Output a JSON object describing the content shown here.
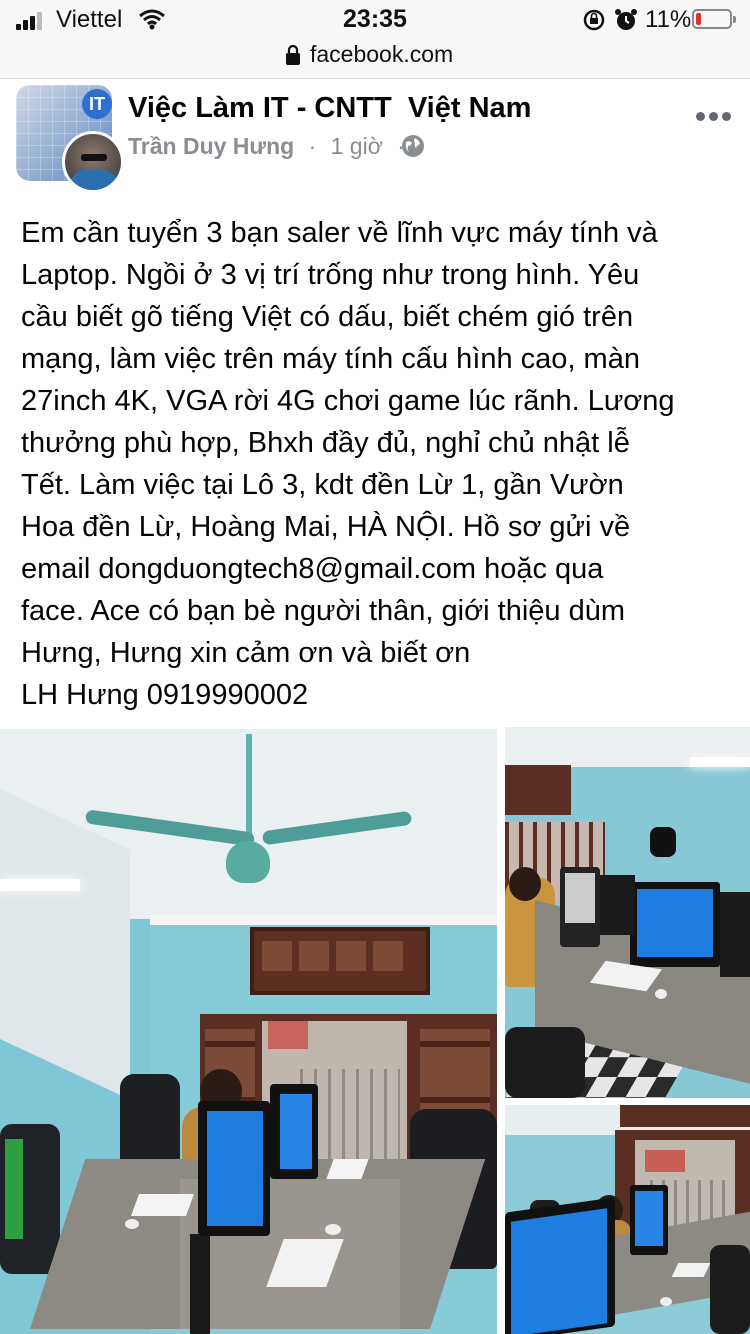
{
  "status_bar": {
    "carrier": "Viettel",
    "time": "23:35",
    "battery_percent": "11%",
    "battery_level": 0.11,
    "icons": [
      "signal-icon",
      "wifi-icon",
      "rotation-lock-icon",
      "alarm-icon",
      "battery-icon"
    ]
  },
  "browser": {
    "url": "facebook.com",
    "icons": [
      "lock-icon"
    ]
  },
  "post": {
    "group_name": "Việc Làm IT - CNTT  Việt Nam",
    "group_badge": "IT",
    "author": "Trần Duy Hưng",
    "time_ago": "1 giờ",
    "separator": "·",
    "icons": [
      "globe-icon",
      "more-options-icon"
    ],
    "body_lines": [
      "Em cần tuyển 3 bạn saler về lĩnh vực máy tính và",
      "Laptop. Ngồi ở 3 vị trí trống như trong hình. Yêu",
      "cầu biết gõ tiếng Việt có dấu, biết chém gió trên",
      "mạng, làm việc trên máy tính cấu hình cao, màn",
      "27inch 4K, VGA rời 4G chơi game lúc rãnh. Lương",
      "thưởng phù hợp, Bhxh đầy đủ, nghỉ chủ nhật lễ",
      "Tết. Làm việc tại Lô 3, kdt đền Lừ 1, gần Vườn",
      "Hoa đền Lừ, Hoàng Mai, HÀ NỘI. Hồ sơ gửi về",
      "email dongduongtech8@gmail.com hoặc qua",
      "face. Ace có bạn bè người thân, giới thiệu dùm",
      "Hưng, Hưng xin cảm ơn và biết ơn",
      "LH Hưng 0919990002"
    ]
  },
  "colors": {
    "wall": "#7fc7d7",
    "ceiling": "#e8eef0",
    "desk": "#8a8680",
    "monitor_screen": "#1f7de0",
    "wood": "#5a2e22",
    "text_primary": "#050505",
    "text_secondary": "#8a8d91",
    "battery_low": "#e0322b"
  }
}
